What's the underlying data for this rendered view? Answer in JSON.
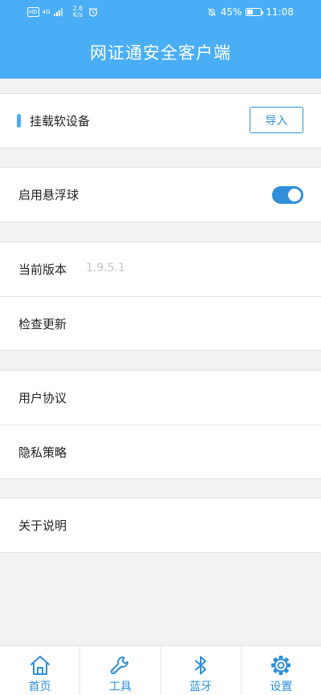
{
  "status_bar": {
    "network_badge": "HD",
    "network_type": "4G",
    "speed_value": "2.6",
    "speed_unit": "K/s",
    "battery": "45%",
    "battery_level": 0.45,
    "time": "11:08"
  },
  "header": {
    "title": "网证通安全客户端"
  },
  "mount": {
    "label": "挂载软设备",
    "import_label": "导入"
  },
  "floating": {
    "label": "启用悬浮球",
    "enabled": true
  },
  "version": {
    "label": "当前版本",
    "value": "1.9.5.1"
  },
  "check_update": {
    "label": "检查更新"
  },
  "user_agreement": {
    "label": "用户协议"
  },
  "privacy_policy": {
    "label": "隐私策略"
  },
  "about": {
    "label": "关于说明"
  },
  "tabbar": {
    "accent_color": "#2f8fd8",
    "items": [
      {
        "label": "首页",
        "icon": "home-icon"
      },
      {
        "label": "工具",
        "icon": "wrench-icon"
      },
      {
        "label": "蓝牙",
        "icon": "bluetooth-icon"
      },
      {
        "label": "设置",
        "icon": "gear-icon"
      }
    ]
  },
  "colors": {
    "header_bg": "#4aaef6",
    "accent": "#2f8fd8",
    "page_bg": "#f2f2f2"
  }
}
